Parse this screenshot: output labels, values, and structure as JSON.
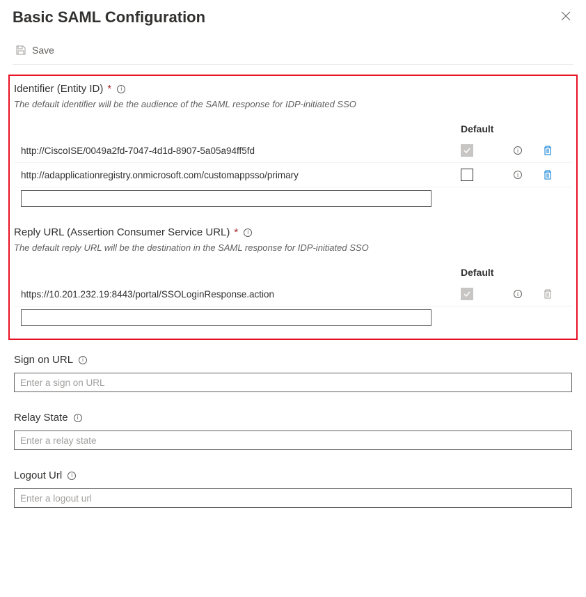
{
  "header": {
    "title": "Basic SAML Configuration"
  },
  "toolbar": {
    "save_label": "Save"
  },
  "identifier_section": {
    "title": "Identifier (Entity ID)",
    "description": "The default identifier will be the audience of the SAML response for IDP-initiated SSO",
    "default_col": "Default",
    "rows": [
      {
        "url": "http://CiscoISE/0049a2fd-7047-4d1d-8907-5a05a94ff5fd",
        "checked": true,
        "deletable_strong": true
      },
      {
        "url": "http://adapplicationregistry.onmicrosoft.com/customappsso/primary",
        "checked": false,
        "deletable_strong": true
      }
    ]
  },
  "reply_section": {
    "title": "Reply URL (Assertion Consumer Service URL)",
    "description": "The default reply URL will be the destination in the SAML response for IDP-initiated SSO",
    "default_col": "Default",
    "rows": [
      {
        "url": "https://10.201.232.19:8443/portal/SSOLoginResponse.action",
        "checked": true,
        "deletable_strong": false
      }
    ]
  },
  "signon_section": {
    "title": "Sign on URL",
    "placeholder": "Enter a sign on URL"
  },
  "relay_section": {
    "title": "Relay State",
    "placeholder": "Enter a relay state"
  },
  "logout_section": {
    "title": "Logout Url",
    "placeholder": "Enter a logout url"
  }
}
